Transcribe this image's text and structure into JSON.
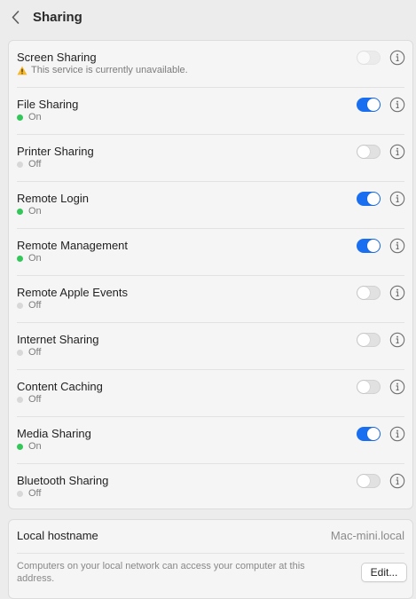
{
  "header": {
    "title": "Sharing"
  },
  "services": [
    {
      "name": "Screen Sharing",
      "status": "This service is currently unavailable.",
      "state": "unavailable",
      "enabled": false
    },
    {
      "name": "File Sharing",
      "status": "On",
      "state": "on",
      "enabled": true
    },
    {
      "name": "Printer Sharing",
      "status": "Off",
      "state": "off",
      "enabled": false
    },
    {
      "name": "Remote Login",
      "status": "On",
      "state": "on",
      "enabled": true
    },
    {
      "name": "Remote Management",
      "status": "On",
      "state": "on",
      "enabled": true
    },
    {
      "name": "Remote Apple Events",
      "status": "Off",
      "state": "off",
      "enabled": false
    },
    {
      "name": "Internet Sharing",
      "status": "Off",
      "state": "off",
      "enabled": false
    },
    {
      "name": "Content Caching",
      "status": "Off",
      "state": "off",
      "enabled": false
    },
    {
      "name": "Media Sharing",
      "status": "On",
      "state": "on",
      "enabled": true
    },
    {
      "name": "Bluetooth Sharing",
      "status": "Off",
      "state": "off",
      "enabled": false
    }
  ],
  "hostname": {
    "label": "Local hostname",
    "value": "Mac-mini.local",
    "description": "Computers on your local network can access your computer at this address.",
    "edit_label": "Edit..."
  },
  "colors": {
    "accent": "#1a6ff0",
    "status_on": "#33c759",
    "status_off": "#d8d8d8",
    "warning": "#f5b82e"
  },
  "icons": {
    "back": "chevron-left-icon",
    "info": "info-circle-icon",
    "warning": "warning-triangle-icon"
  }
}
